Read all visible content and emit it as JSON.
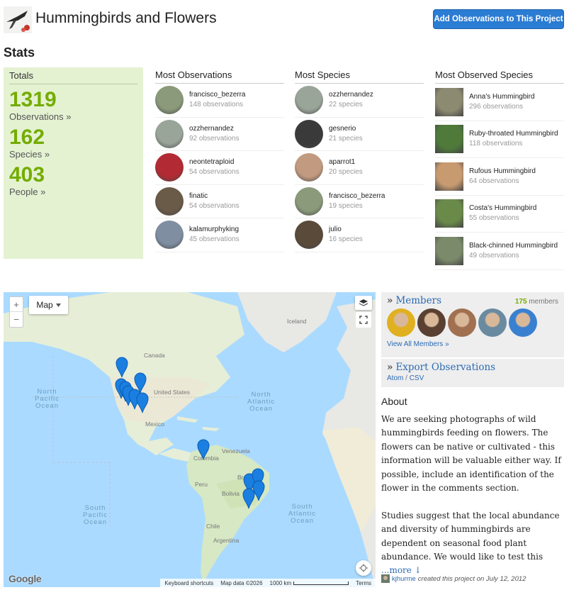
{
  "header": {
    "title": "Hummingbirds and Flowers",
    "add_button": "Add Observations to This Project"
  },
  "stats": {
    "heading": "Stats",
    "totals_heading": "Totals",
    "observations_count": "1319",
    "observations_label": "Observations »",
    "species_count": "162",
    "species_label": "Species »",
    "people_count": "403",
    "people_label": "People »"
  },
  "most_observations": {
    "heading": "Most Observations",
    "items": [
      {
        "name": "francisco_bezerra",
        "stat": "148 observations",
        "color": "#8a9a7a"
      },
      {
        "name": "ozzhernandez",
        "stat": "92 observations",
        "color": "#9aa59a"
      },
      {
        "name": "neontetraploid",
        "stat": "54 observations",
        "color": "#b22a33"
      },
      {
        "name": "finatic",
        "stat": "54 observations",
        "color": "#6a5a48"
      },
      {
        "name": "kalamurphyking",
        "stat": "45 observations",
        "color": "#7f8ea0"
      }
    ]
  },
  "most_species": {
    "heading": "Most Species",
    "items": [
      {
        "name": "ozzhernandez",
        "stat": "22 species",
        "color": "#9aa59a"
      },
      {
        "name": "gesnerio",
        "stat": "21 species",
        "color": "#3a3a3a"
      },
      {
        "name": "aparrot1",
        "stat": "20 species",
        "color": "#c29a80"
      },
      {
        "name": "francisco_bezerra",
        "stat": "19 species",
        "color": "#8a9a7a"
      },
      {
        "name": "julio",
        "stat": "16 species",
        "color": "#5a4a3a"
      }
    ]
  },
  "most_observed_species": {
    "heading": "Most Observed Species",
    "items": [
      {
        "name": "Anna's Hummingbird",
        "stat": "296 observations",
        "color": "#8c8a70"
      },
      {
        "name": "Ruby-throated Hummingbird",
        "stat": "118 observations",
        "color": "#4f7a3a"
      },
      {
        "name": "Rufous Hummingbird",
        "stat": "64 observations",
        "color": "#c79a70"
      },
      {
        "name": "Costa's Hummingbird",
        "stat": "55 observations",
        "color": "#6a8a4a"
      },
      {
        "name": "Black-chinned Hummingbird",
        "stat": "49 observations",
        "color": "#7a8a6a"
      }
    ]
  },
  "map": {
    "type_label": "Map",
    "zoom_in": "+",
    "zoom_out": "−",
    "labels": {
      "iceland": "Iceland",
      "canada": "Canada",
      "united_states": "United States",
      "mexico": "Mexico",
      "venezuela": "Venezuela",
      "colombia": "Colombia",
      "peru": "Peru",
      "bolivia": "Bolivia",
      "brazil": "Brazil",
      "chile": "Chile",
      "argentina": "Argentina",
      "north_pacific": "North\nPacific\nOcean",
      "north_atlantic": "North\nAtlantic\nOcean",
      "south_pacific": "South\nPacific\nOcean",
      "south_atlantic": "South\nAtlantic\nOcean"
    },
    "google": "Google",
    "keyboard": "Keyboard shortcuts",
    "map_data": "Map data ©2026",
    "scale": "1000 km",
    "terms": "Terms",
    "marker_color": "#1a7fe0"
  },
  "members": {
    "title": "Members",
    "count": "175",
    "count_label": "members",
    "view_all": "View All Members »",
    "avatars": [
      "#e0b020",
      "#5a4030",
      "#a07050",
      "#6a8aa0",
      "#3a80d0"
    ]
  },
  "export": {
    "title": "Export Observations",
    "atom": "Atom",
    "sep": " / ",
    "csv": "CSV"
  },
  "about": {
    "heading": "About",
    "p1": "We are seeking photographs of wild hummingbirds feeding on flowers. The flowers can be native or cultivated - this information will be valuable either way. If possible, include an identification of the flower in the comments section.",
    "p2": "Studies suggest that the local abundance and diversity of hummingbirds are dependent on seasonal food plant abundance. We would like to test this ",
    "more": "...more ↓"
  },
  "created": {
    "user": "kjhurme",
    "text": "created this project on July 12, 2012"
  }
}
